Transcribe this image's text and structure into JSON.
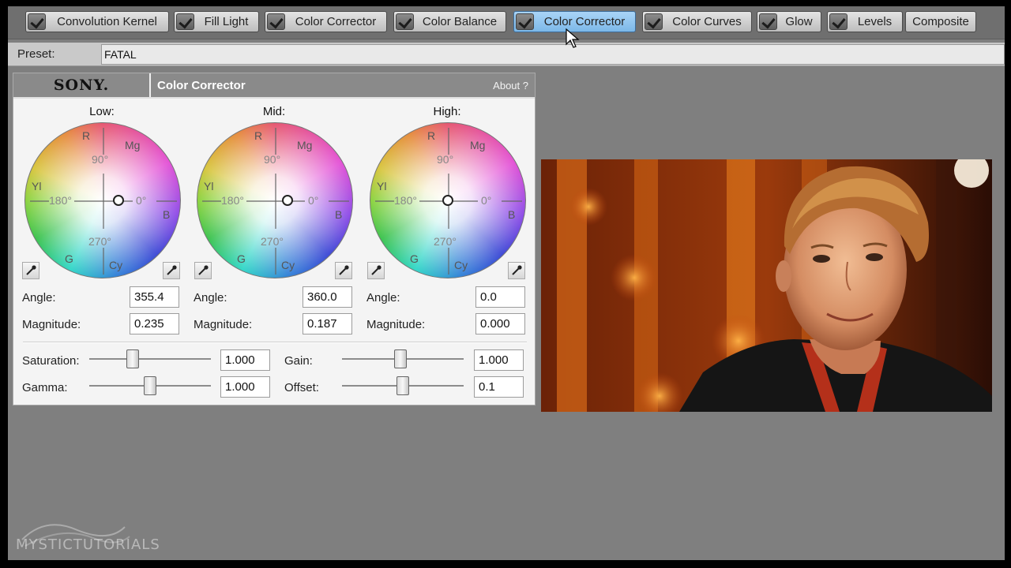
{
  "tabs": [
    {
      "label": "Convolution Kernel",
      "checked": true,
      "active": false
    },
    {
      "label": "Fill Light",
      "checked": true,
      "active": false
    },
    {
      "label": "Color Corrector",
      "checked": true,
      "active": false
    },
    {
      "label": "Color Balance",
      "checked": true,
      "active": false
    },
    {
      "label": "Color Corrector",
      "checked": true,
      "active": true
    },
    {
      "label": "Color Curves",
      "checked": true,
      "active": false
    },
    {
      "label": "Glow",
      "checked": true,
      "active": false
    },
    {
      "label": "Levels",
      "checked": true,
      "active": false
    },
    {
      "label": "Composite",
      "checked": false,
      "active": false
    }
  ],
  "preset": {
    "label": "Preset:",
    "value": "FATAL"
  },
  "panel": {
    "brand": "SONY.",
    "title": "Color Corrector",
    "about": "About  ?",
    "wheel_labels": {
      "r": "R",
      "mg": "Mg",
      "b": "B",
      "cy": "Cy",
      "g": "G",
      "yl": "Yl",
      "d90": "90°",
      "d180": "180°",
      "d0": "0°",
      "d270": "270°"
    },
    "wheels": [
      {
        "title": "Low:",
        "angle_label": "Angle:",
        "angle": "355.4",
        "magnitude_label": "Magnitude:",
        "magnitude": "0.235"
      },
      {
        "title": "Mid:",
        "angle_label": "Angle:",
        "angle": "360.0",
        "magnitude_label": "Magnitude:",
        "magnitude": "0.187"
      },
      {
        "title": "High:",
        "angle_label": "Angle:",
        "angle": "0.0",
        "magnitude_label": "Magnitude:",
        "magnitude": "0.000"
      }
    ],
    "sliders": {
      "saturation": {
        "label": "Saturation:",
        "value": "1.000",
        "level": 0.34
      },
      "gamma": {
        "label": "Gamma:",
        "value": "1.000",
        "level": 0.5
      },
      "gain": {
        "label": "Gain:",
        "value": "1.000",
        "level": 0.48
      },
      "offset": {
        "label": "Offset:",
        "value": "0.1",
        "level": 0.5
      }
    }
  },
  "watermark": "MYSTICTUTORIALS",
  "colors": {
    "active_tab": "#8fc5f0",
    "panel_header": "#8a8a8a",
    "background": "#7f7f7f"
  }
}
